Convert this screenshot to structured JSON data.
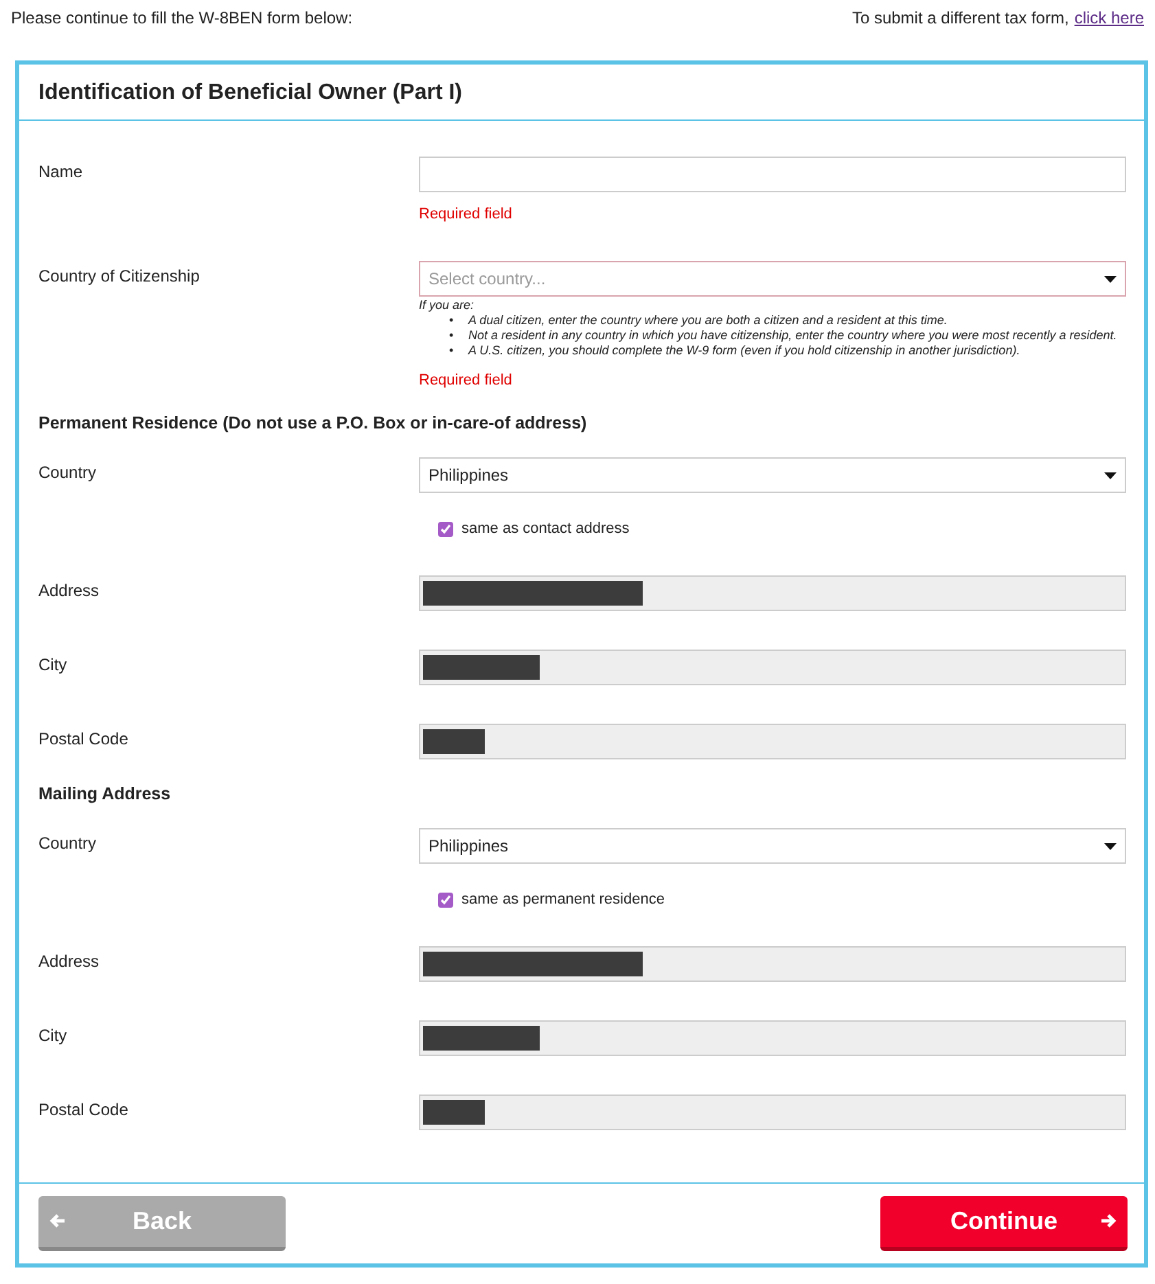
{
  "intro": "Please continue to fill the W-8BEN form below:",
  "switch": {
    "text": "To submit a different tax form,",
    "link": "click here"
  },
  "card": {
    "title": "Identification of Beneficial Owner (Part I)"
  },
  "sections": [
    {
      "rows": [
        {
          "kind": "text",
          "label": "Name",
          "error": "Required field"
        },
        {
          "kind": "select",
          "label": "Country of Citizenship",
          "placeholder": "Select country...",
          "note": {
            "intro": "If you are:",
            "items": [
              {
                "marker": "•",
                "text": "A dual citizen, enter the country where you are both a citizen and a resident at this time."
              },
              {
                "marker": "•",
                "text": "Not a resident in any country in which you have citizenship, enter the country where you were most recently a resident."
              },
              {
                "marker": "•",
                "text": "A U.S. citizen, you should complete the W-9 form (even if you hold citizenship in another jurisdiction)."
              }
            ]
          },
          "error": "Required field"
        }
      ]
    },
    {
      "heading": "Permanent Residence (Do not use a P.O. Box or in-care-of address)",
      "rows": [
        {
          "kind": "select",
          "label": "Country",
          "value": "Philippines",
          "checkbox": {
            "label": "same as contact address",
            "checked": true
          }
        },
        {
          "kind": "redacted",
          "label": "Address"
        },
        {
          "kind": "redacted",
          "label": "City"
        },
        {
          "kind": "redacted",
          "label": "Postal Code"
        }
      ]
    },
    {
      "heading": "Mailing Address",
      "rows": [
        {
          "kind": "select",
          "label": "Country",
          "value": "Philippines",
          "checkbox": {
            "label": "same as permanent residence",
            "checked": true
          }
        },
        {
          "kind": "redacted",
          "label": "Address"
        },
        {
          "kind": "redacted",
          "label": "City"
        },
        {
          "kind": "redacted",
          "label": "Postal Code"
        }
      ]
    }
  ],
  "buttons": {
    "back": "Back",
    "continue": "Continue"
  }
}
